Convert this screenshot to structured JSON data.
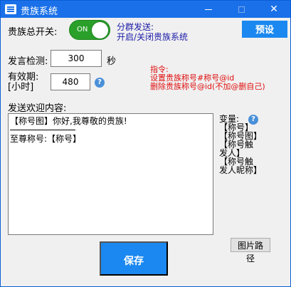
{
  "window": {
    "title": "贵族系统"
  },
  "main_switch": {
    "label": "贵族总开关:",
    "toggle_text": "ON",
    "state": "on"
  },
  "group_send_hint": {
    "line1": "分群发送:",
    "line2": "开启/关闭贵族系统"
  },
  "preset_button": "预设",
  "speak_check": {
    "label": "发言检测:",
    "value": "300",
    "unit": "秒"
  },
  "validity": {
    "label_line1": "有效期:",
    "label_line2": "[小时]",
    "value": "480"
  },
  "commands": {
    "title": "指令:",
    "line1": "设置贵族称号#称号@id",
    "line2": "删除贵族称号@id(不加@删自己)"
  },
  "welcome": {
    "label": "发送欢迎内容:",
    "line1": "【称号图】你好,我尊敬的贵族!",
    "line2": "至尊称号:【称号】"
  },
  "variables": {
    "title": "变量:",
    "items": [
      "【称号】",
      "【称号图】",
      "【称号触发人】",
      "【称号触发人昵称】"
    ]
  },
  "image_path_button": "图片路径",
  "save_button": "保存",
  "colors": {
    "titlebar": "#1a70e8",
    "accent_button": "#1a88f0",
    "toggle_on": "#2aa02a",
    "blue_text": "#1a1aa8",
    "red_text": "#e01010"
  }
}
